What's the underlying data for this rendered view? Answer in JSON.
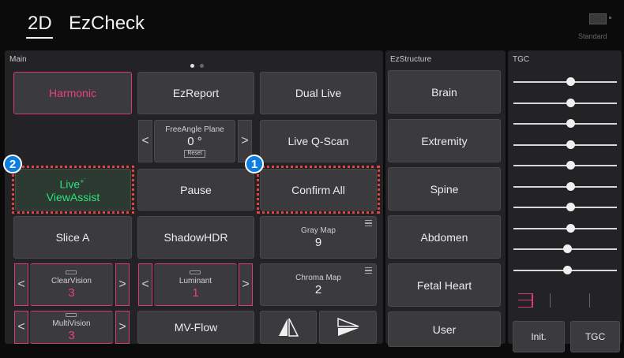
{
  "header": {
    "tab_2d": "2D",
    "tab_ezcheck": "EzCheck",
    "standard_label": "Standard",
    "standard_icon": "monitor-icon"
  },
  "main": {
    "title": "Main",
    "page_count": 2,
    "active_page": 1,
    "harmonic": "Harmonic",
    "ezreport": "EzReport",
    "dual_live": "Dual Live",
    "freeangle": {
      "title": "FreeAngle Plane",
      "value": "0 °",
      "reset": "Reset"
    },
    "live_qscan": "Live Q-Scan",
    "live_viewassist": {
      "line1": "Live",
      "line2": "ViewAssist",
      "sparkle": "+˙"
    },
    "pause": "Pause",
    "confirm_all": "Confirm All",
    "slice_a": "Slice A",
    "shadowhdr": "ShadowHDR",
    "gray_map": {
      "title": "Gray Map",
      "value": "9"
    },
    "clearvision": {
      "title": "ClearVision",
      "value": "3"
    },
    "luminant": {
      "title": "Luminant",
      "value": "1"
    },
    "chroma_map": {
      "title": "Chroma Map",
      "value": "2"
    },
    "multivision": {
      "title": "MultiVision",
      "value": "3"
    },
    "mv_flow": "MV-Flow",
    "arrow_left": "<",
    "arrow_right": ">"
  },
  "ezstructure": {
    "title": "EzStructure",
    "items": [
      "Brain",
      "Extremity",
      "Spine",
      "Abdomen",
      "Fetal Heart",
      "User"
    ]
  },
  "tgc": {
    "title": "TGC",
    "init_label": "Init.",
    "tgc_label": "TGC",
    "slider_levels": [
      0.55,
      0.55,
      0.55,
      0.55,
      0.55,
      0.55,
      0.55,
      0.55,
      0.52,
      0.52
    ]
  },
  "badges": {
    "one": "1",
    "two": "2"
  },
  "colors": {
    "accent_pink": "#e8407f",
    "accent_green": "#2de27a",
    "badge_blue": "#0f7ce0",
    "highlight_red": "#e2453d"
  }
}
